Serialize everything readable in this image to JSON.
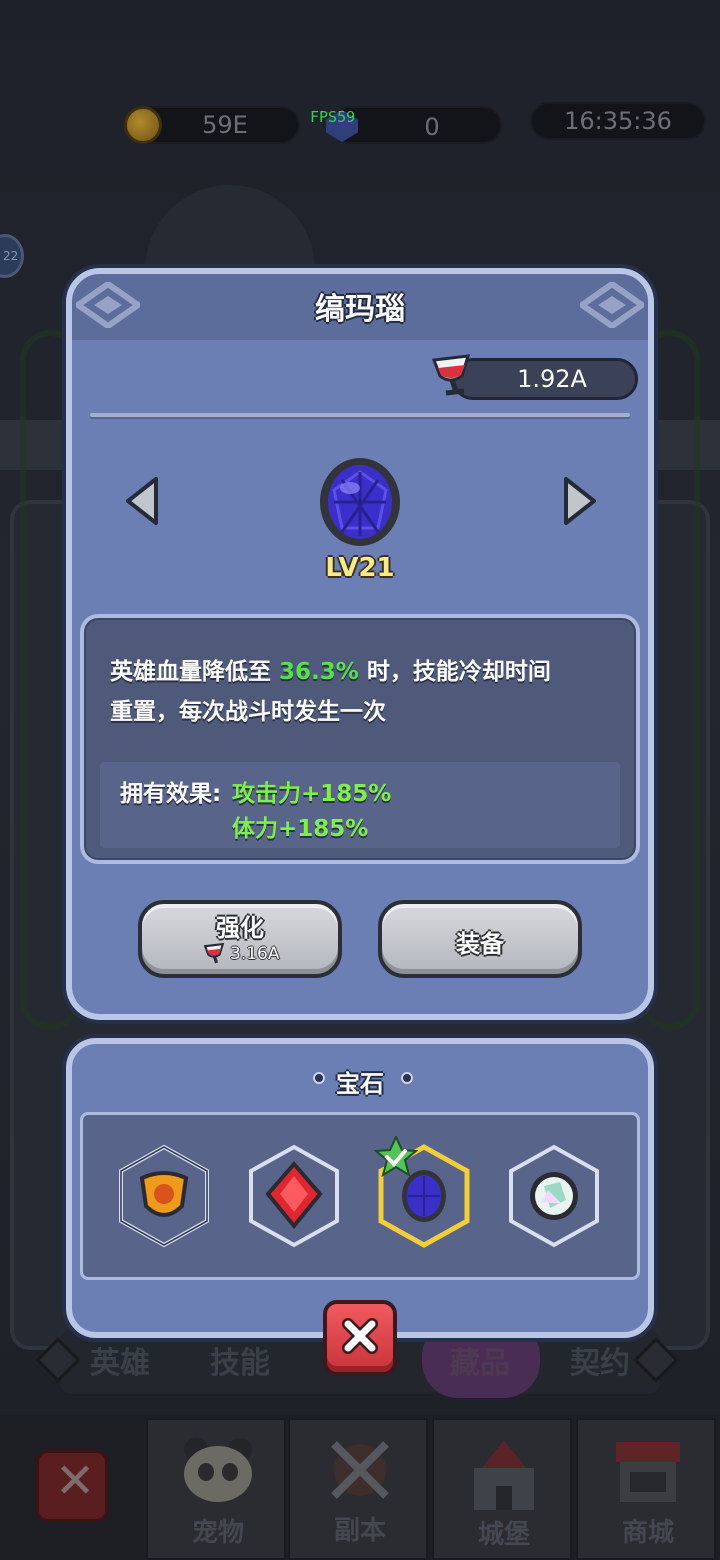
{
  "status_bar": {
    "coins": "59E",
    "gems": "0",
    "fps": "FPS59",
    "time": "16:35:36",
    "level_badge": "22"
  },
  "background_tabs": [
    "英雄",
    "技能",
    "藏品",
    "契约"
  ],
  "bottom_nav": [
    "宠物",
    "副本",
    "城堡",
    "商城"
  ],
  "dialog": {
    "title": "缟玛瑙",
    "resource_amount": "1.92A",
    "item_level": "LV21",
    "description_prefix": "英雄血量降低至",
    "description_highlight": "36.3%",
    "description_suffix": "时，技能冷却时间",
    "description_line2": "重置，每次战斗时发生一次",
    "effect_label": "拥有效果:",
    "effect_values": [
      "攻击力+185%",
      "体力+185%"
    ],
    "upgrade_label": "强化",
    "upgrade_cost": "3.16A",
    "equip_label": "装备",
    "colors": {
      "highlight": "#56e04b",
      "effect": "#7ff04a",
      "level": "#f6ea8b"
    }
  },
  "gem_panel": {
    "title": "宝石",
    "gems": [
      {
        "icon": "amber-gem-icon",
        "selected": false
      },
      {
        "icon": "ruby-gem-icon",
        "selected": false
      },
      {
        "icon": "onyx-gem-icon",
        "selected": true
      },
      {
        "icon": "crystal-gem-icon",
        "selected": false
      }
    ]
  }
}
